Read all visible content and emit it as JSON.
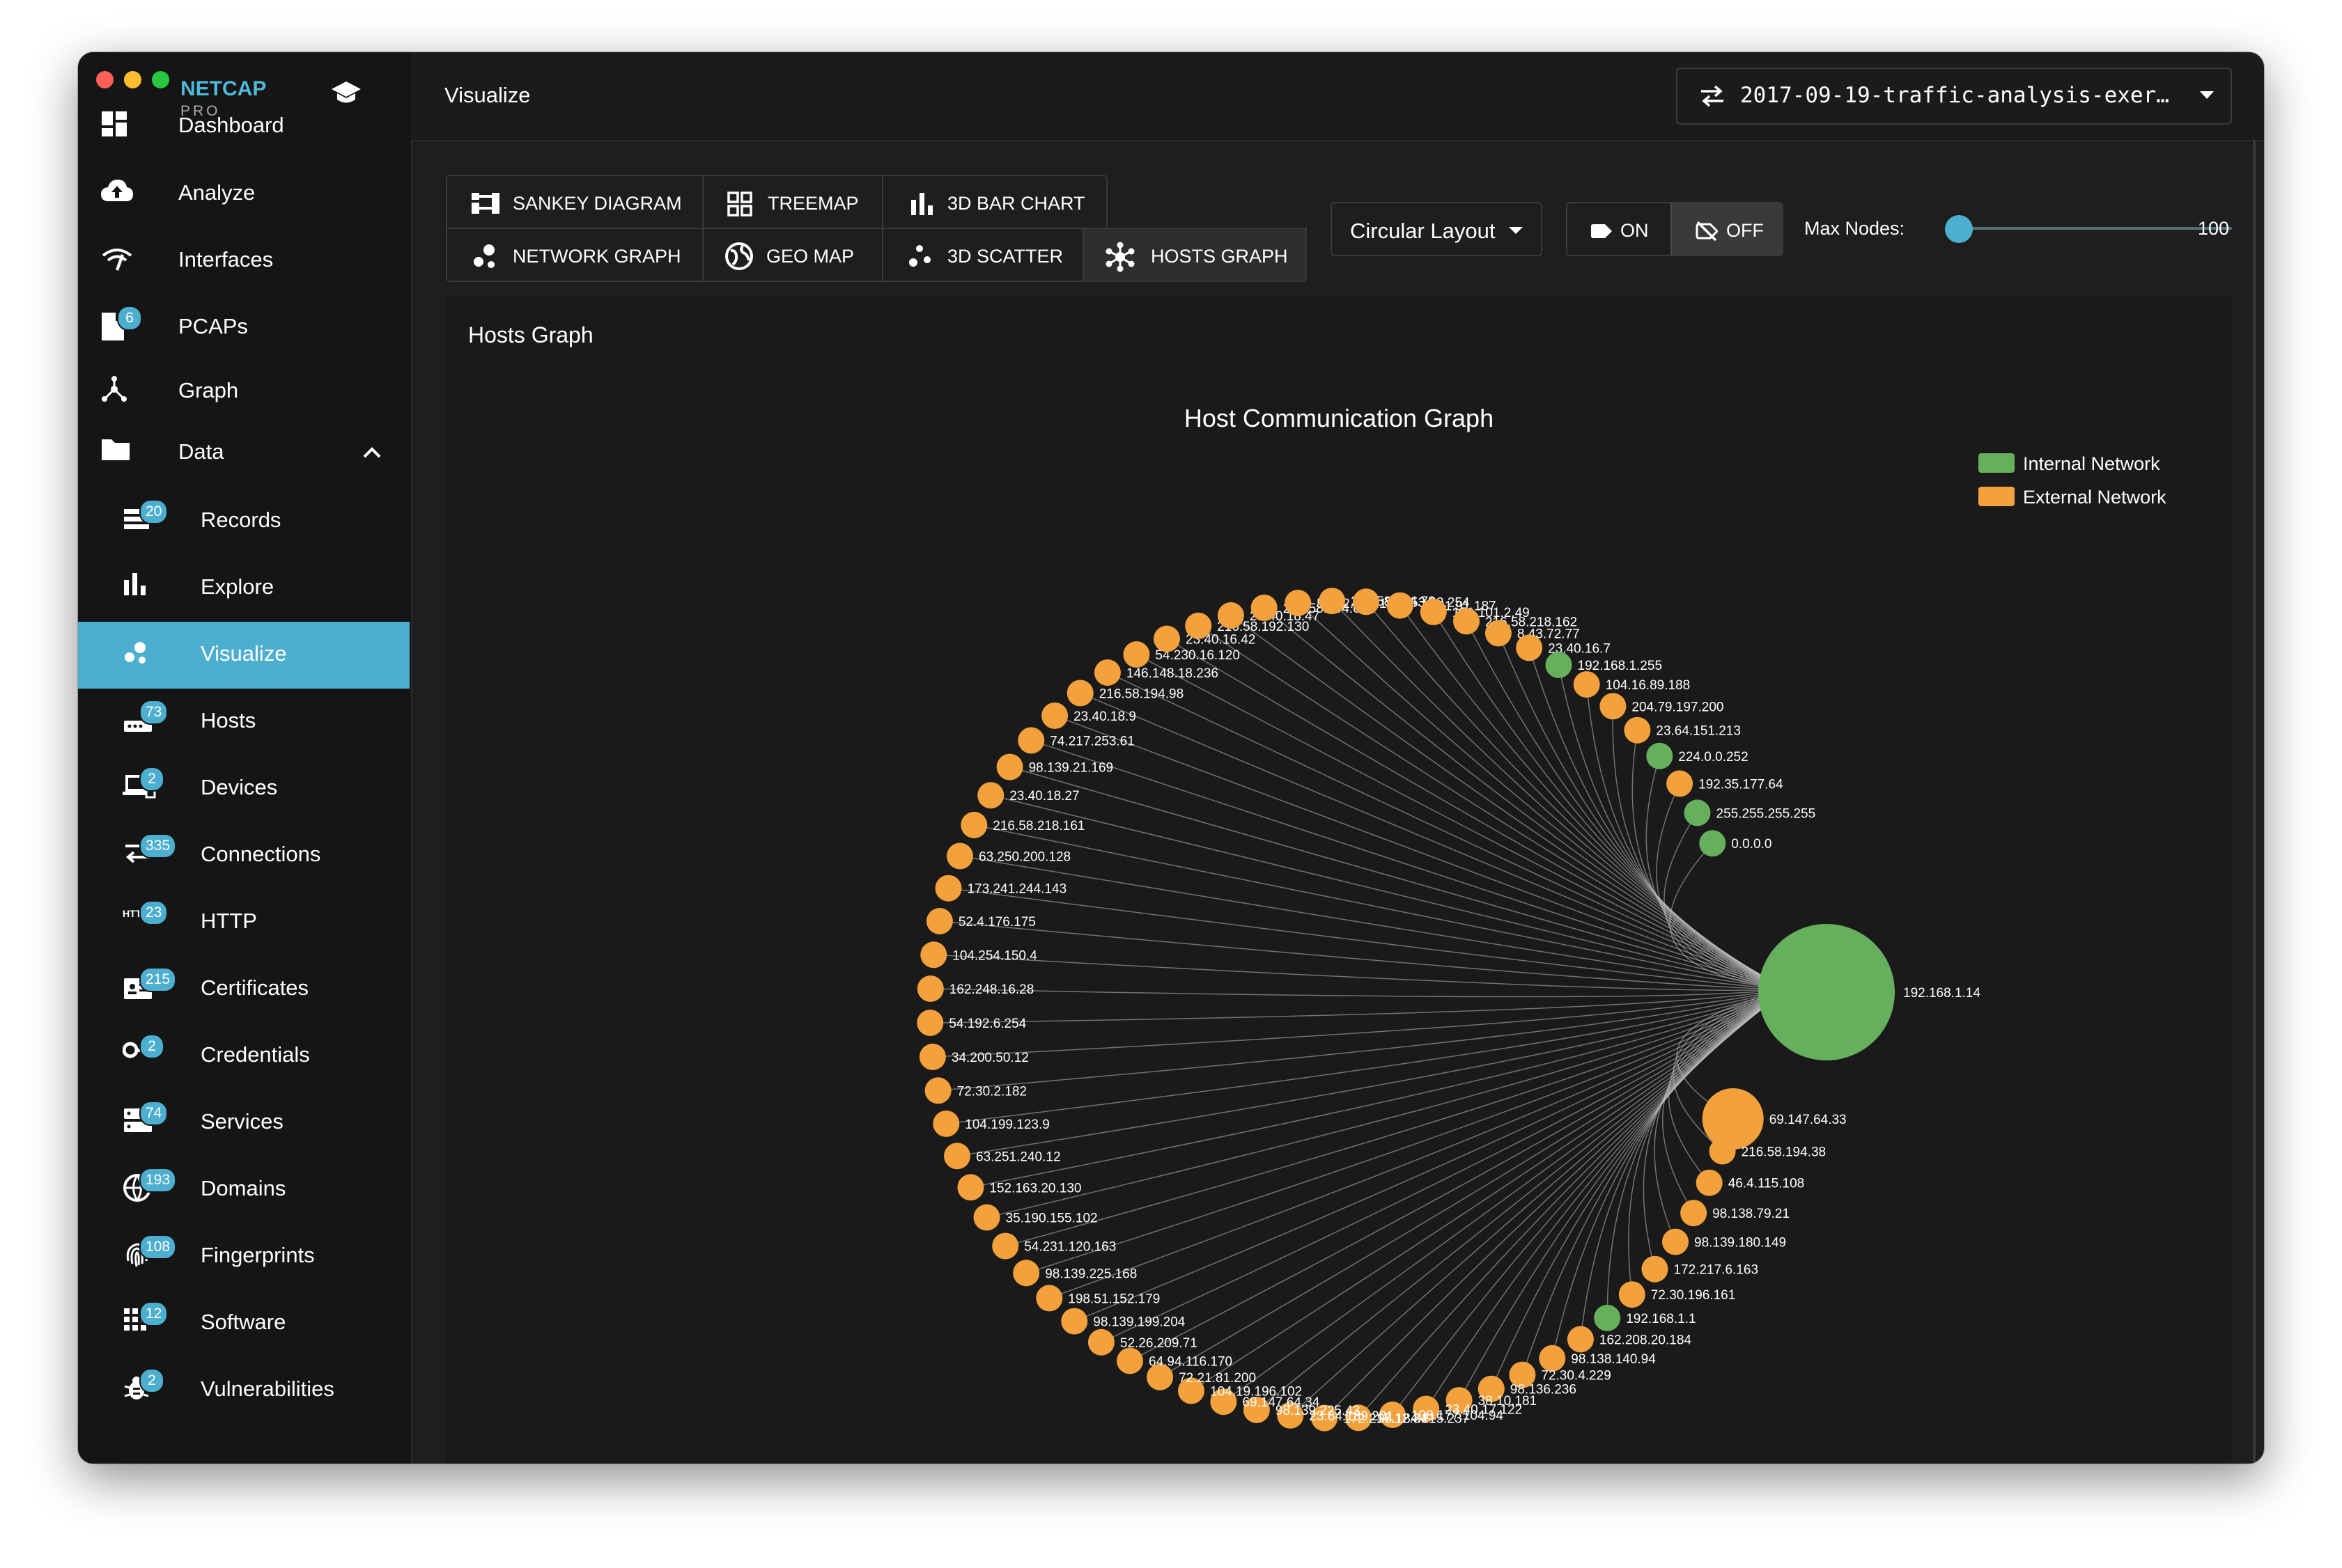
{
  "app": {
    "name": "NETCAP",
    "edition": "PRO"
  },
  "sidebar": {
    "items": [
      {
        "label": "Dashboard",
        "icon": "dashboard-icon"
      },
      {
        "label": "Analyze",
        "icon": "cloud-upload-icon"
      },
      {
        "label": "Interfaces",
        "icon": "wifi-icon"
      },
      {
        "label": "PCAPs",
        "icon": "file-icon",
        "badge": "6"
      },
      {
        "label": "Graph",
        "icon": "graph-icon"
      },
      {
        "label": "Data",
        "icon": "folder-icon"
      },
      {
        "label": "Records",
        "icon": "records-icon",
        "badge": "20"
      },
      {
        "label": "Explore",
        "icon": "bar-chart-icon"
      },
      {
        "label": "Visualize",
        "icon": "bubble-icon"
      },
      {
        "label": "Hosts",
        "icon": "router-icon",
        "badge": "73"
      },
      {
        "label": "Devices",
        "icon": "devices-icon",
        "badge": "2"
      },
      {
        "label": "Connections",
        "icon": "arrows-icon",
        "badge": "335"
      },
      {
        "label": "HTTP",
        "icon": "http-icon",
        "badge": "23"
      },
      {
        "label": "Certificates",
        "icon": "certificate-icon",
        "badge": "215"
      },
      {
        "label": "Credentials",
        "icon": "key-icon",
        "badge": "2"
      },
      {
        "label": "Services",
        "icon": "server-icon",
        "badge": "74"
      },
      {
        "label": "Domains",
        "icon": "globe-icon",
        "badge": "193"
      },
      {
        "label": "Fingerprints",
        "icon": "fingerprint-icon",
        "badge": "108"
      },
      {
        "label": "Software",
        "icon": "apps-icon",
        "badge": "12"
      },
      {
        "label": "Vulnerabilities",
        "icon": "bug-icon",
        "badge": "2"
      }
    ]
  },
  "header": {
    "title": "Visualize",
    "file": "2017-09-19-traffic-analysis-exer…"
  },
  "tabs": {
    "row1": [
      "SANKEY DIAGRAM",
      "TREEMAP",
      "3D BAR CHART"
    ],
    "row2": [
      "NETWORK GRAPH",
      "GEO MAP",
      "3D SCATTER",
      "HOSTS GRAPH"
    ]
  },
  "controls": {
    "layout": "Circular Layout",
    "on": "ON",
    "off": "OFF",
    "max_nodes_label": "Max Nodes:",
    "max_nodes_value": "100",
    "max_nodes_fraction": 0.0
  },
  "panel": {
    "title": "Hosts Graph"
  },
  "graph": {
    "title": "Host Communication Graph",
    "legend": [
      {
        "label": "Internal Network",
        "color": "#66b05d"
      },
      {
        "label": "External Network",
        "color": "#f2a13c"
      }
    ],
    "center_node": "192.168.1.14",
    "labeled_nodes": [
      {
        "label": "69.147.64.33",
        "type": "external",
        "size": "large"
      },
      {
        "label": "216.58.194.38",
        "type": "external"
      },
      {
        "label": "46.4.115.108",
        "type": "external"
      },
      {
        "label": "98.138.79.21",
        "type": "external"
      },
      {
        "label": "98.139.180.149",
        "type": "external"
      },
      {
        "label": "172.217.6.163",
        "type": "external"
      },
      {
        "label": "72.30.196.161",
        "type": "external"
      },
      {
        "label": "192.168.1.1",
        "type": "internal"
      },
      {
        "label": "162.208.20.184",
        "type": "external"
      },
      {
        "label": "98.138.140.94",
        "type": "external"
      },
      {
        "label": "72.30.4.229",
        "type": "external"
      },
      {
        "label": "98.136.236",
        "type": "external"
      },
      {
        "label": "38.10.181",
        "type": "external"
      },
      {
        "label": "23.40.17.122",
        "type": "external"
      },
      {
        "label": "108.177.104.94",
        "type": "external"
      },
      {
        "label": "98.184.215.237",
        "type": "external"
      },
      {
        "label": "172.217.12.34",
        "type": "external"
      },
      {
        "label": "23.64.189.201",
        "type": "external"
      },
      {
        "label": "98.139.225.43",
        "type": "external"
      },
      {
        "label": "69.147.64.34",
        "type": "external"
      },
      {
        "label": "104.19.196.102",
        "type": "external"
      },
      {
        "label": "72.21.81.200",
        "type": "external"
      },
      {
        "label": "64.94.116.170",
        "type": "external"
      },
      {
        "label": "52.26.209.71",
        "type": "external"
      },
      {
        "label": "98.139.199.204",
        "type": "external"
      },
      {
        "label": "198.51.152.179",
        "type": "external"
      },
      {
        "label": "98.139.225.168",
        "type": "external"
      },
      {
        "label": "54.231.120.163",
        "type": "external"
      },
      {
        "label": "35.190.155.102",
        "type": "external"
      },
      {
        "label": "152.163.20.130",
        "type": "external"
      },
      {
        "label": "63.251.240.12",
        "type": "external"
      },
      {
        "label": "104.199.123.9",
        "type": "external"
      },
      {
        "label": "72.30.2.182",
        "type": "external"
      },
      {
        "label": "34.200.50.12",
        "type": "external"
      },
      {
        "label": "54.192.6.254",
        "type": "external"
      },
      {
        "label": "162.248.16.28",
        "type": "external"
      },
      {
        "label": "104.254.150.4",
        "type": "external"
      },
      {
        "label": "52.4.176.175",
        "type": "external"
      },
      {
        "label": "173.241.244.143",
        "type": "external"
      },
      {
        "label": "63.250.200.128",
        "type": "external"
      },
      {
        "label": "216.58.218.161",
        "type": "external"
      },
      {
        "label": "23.40.18.27",
        "type": "external"
      },
      {
        "label": "98.139.21.169",
        "type": "external"
      },
      {
        "label": "74.217.253.61",
        "type": "external"
      },
      {
        "label": "23.40.18.9",
        "type": "external"
      },
      {
        "label": "216.58.194.98",
        "type": "external"
      },
      {
        "label": "146.148.18.236",
        "type": "external"
      },
      {
        "label": "54.230.16.120",
        "type": "external"
      },
      {
        "label": "23.40.16.42",
        "type": "external"
      },
      {
        "label": "216.58.192.130",
        "type": "external"
      },
      {
        "label": "23.40.18.47",
        "type": "external"
      },
      {
        "label": "216.58.194.66",
        "type": "external"
      },
      {
        "label": "52.22.127.145",
        "type": "external"
      },
      {
        "label": "216.58.194.70",
        "type": "external"
      },
      {
        "label": "54.153.22.254",
        "type": "external"
      },
      {
        "label": "72.21.91.187",
        "type": "external"
      },
      {
        "label": "151.101.2.49",
        "type": "external"
      },
      {
        "label": "216.58.218.162",
        "type": "external"
      },
      {
        "label": "8.43.72.77",
        "type": "external"
      },
      {
        "label": "23.40.16.7",
        "type": "external"
      },
      {
        "label": "192.168.1.255",
        "type": "internal"
      },
      {
        "label": "104.16.89.188",
        "type": "external"
      },
      {
        "label": "204.79.197.200",
        "type": "external"
      },
      {
        "label": "23.64.151.213",
        "type": "external"
      },
      {
        "label": "224.0.0.252",
        "type": "internal"
      },
      {
        "label": "192.35.177.64",
        "type": "external"
      },
      {
        "label": "255.255.255.255",
        "type": "internal"
      },
      {
        "label": "0.0.0.0",
        "type": "internal"
      }
    ]
  }
}
